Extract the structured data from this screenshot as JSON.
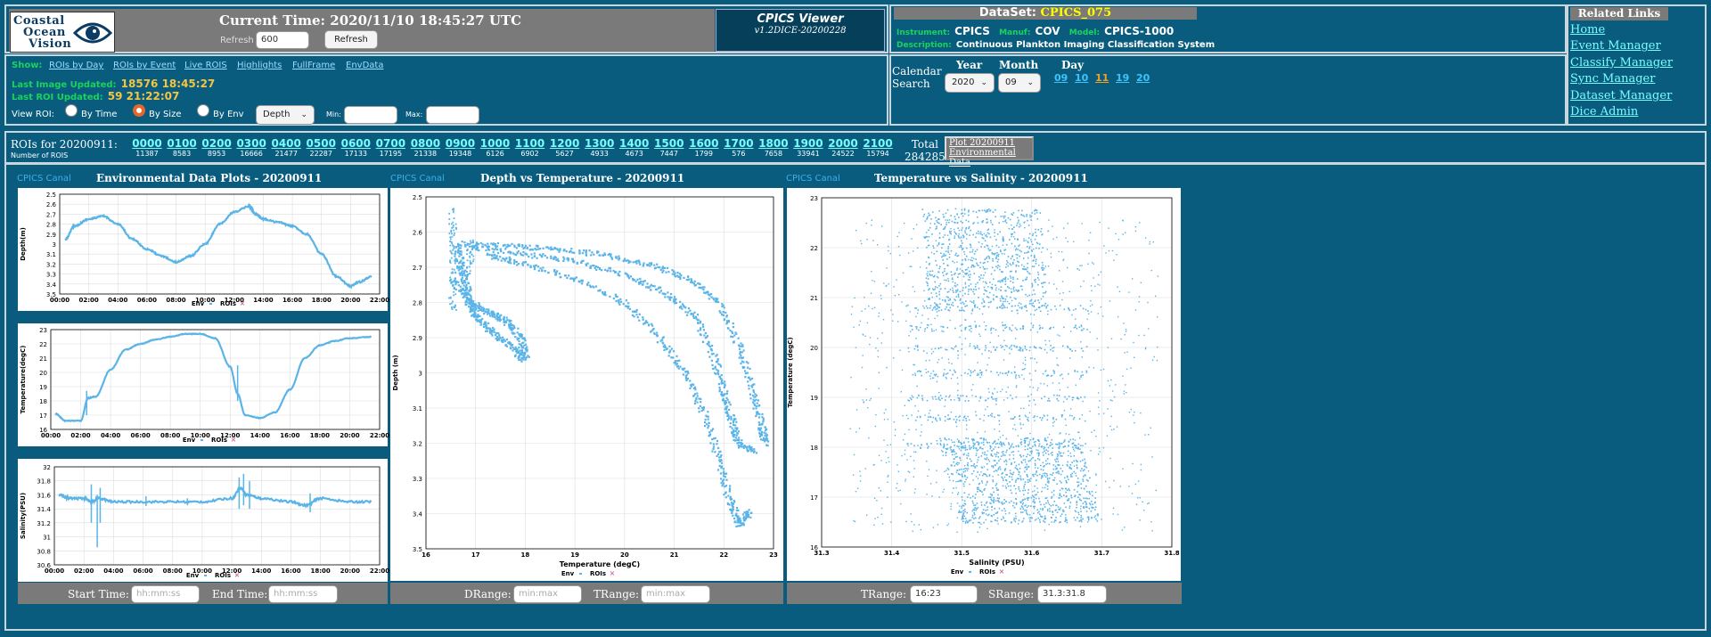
{
  "header": {
    "logo": {
      "line1": "Coastal",
      "line2": "Ocean",
      "line3": "Vision"
    },
    "current_time": "Current Time: 2020/11/10 18:45:27 UTC",
    "refresh_label": "Refresh",
    "refresh_value": "600",
    "refresh_button": "Refresh",
    "viewer_title": "CPICS Viewer",
    "viewer_version": "v1.2DICE-20200228"
  },
  "dataset": {
    "label": "DataSet:",
    "name": "CPICS_075",
    "instrument_label": "Instrument:",
    "instrument": "CPICS",
    "manuf_label": "Manuf:",
    "manuf": "COV",
    "model_label": "Model:",
    "model": "CPICS-1000",
    "description_label": "Description:",
    "description": "Continuous Plankton Imaging Classification System"
  },
  "related_links": {
    "title": "Related Links",
    "items": [
      "Home",
      "Event Manager",
      "Classify Manager",
      "Sync Manager",
      "Dataset Manager",
      "Dice Admin"
    ]
  },
  "show": {
    "label": "Show:",
    "links": [
      "ROIs by Day",
      "ROIs by Event",
      "Live ROIS",
      "Highlights",
      "FullFrame",
      "EnvData"
    ],
    "last_image_label": "Last Image Updated:",
    "last_image_value": "18576 18:45:27",
    "last_roi_label": "Last ROI Updated:",
    "last_roi_value": "59 21:22:07",
    "view_roi_label": "View ROI:",
    "radio_time": "By Time",
    "radio_size": "By Size",
    "radio_env": "By Env",
    "env_select": "Depth",
    "min_label": "Min:",
    "max_label": "Max:"
  },
  "calendar": {
    "label1": "Calendar",
    "label2": "Search",
    "year_label": "Year",
    "year": "2020",
    "month_label": "Month",
    "month": "09",
    "day_label": "Day",
    "days": [
      "09",
      "10",
      "11",
      "19",
      "20"
    ],
    "selected_day": "11"
  },
  "rois": {
    "title": "ROIs for 20200911:",
    "subtitle": "Number of ROIS",
    "hours": [
      {
        "h": "0000",
        "c": "11387"
      },
      {
        "h": "0100",
        "c": "8583"
      },
      {
        "h": "0200",
        "c": "8953"
      },
      {
        "h": "0300",
        "c": "16666"
      },
      {
        "h": "0400",
        "c": "21477"
      },
      {
        "h": "0500",
        "c": "22287"
      },
      {
        "h": "0600",
        "c": "17133"
      },
      {
        "h": "0700",
        "c": "17195"
      },
      {
        "h": "0800",
        "c": "21338"
      },
      {
        "h": "0900",
        "c": "19348"
      },
      {
        "h": "1000",
        "c": "6126"
      },
      {
        "h": "1100",
        "c": "6902"
      },
      {
        "h": "1200",
        "c": "5627"
      },
      {
        "h": "1300",
        "c": "4933"
      },
      {
        "h": "1400",
        "c": "4673"
      },
      {
        "h": "1500",
        "c": "7447"
      },
      {
        "h": "1600",
        "c": "1799"
      },
      {
        "h": "1700",
        "c": "576"
      },
      {
        "h": "1800",
        "c": "7658"
      },
      {
        "h": "1900",
        "c": "33941"
      },
      {
        "h": "2000",
        "c": "24522"
      },
      {
        "h": "2100",
        "c": "15794"
      }
    ],
    "total_label": "Total",
    "total": "284285",
    "plot_button_line1": "Plot 20200911",
    "plot_button_line2": "Environmental Data"
  },
  "plots": {
    "cp_tag": "CPICS Canal",
    "env_title": "Environmental Data Plots - 20200911",
    "dt_title": "Depth vs Temperature - 20200911",
    "ts_title": "Temperature vs Salinity - 20200911",
    "legend_env": "Env",
    "legend_rois": "ROIs"
  },
  "controls": {
    "start_label": "Start Time:",
    "start_placeholder": "hh:mm:ss",
    "end_label": "End Time:",
    "end_placeholder": "hh:mm:ss",
    "drange_label": "DRange:",
    "drange_placeholder": "min:max",
    "trange_label": "TRange:",
    "trange_placeholder": "min:max",
    "trange2_label": "TRange:",
    "trange2_value": "16:23",
    "srange_label": "SRange:",
    "srange_value": "31.3:31.8"
  },
  "chart_data": [
    {
      "type": "line",
      "ylabel": "Depth(m)",
      "x_ticks": [
        "00:00",
        "02:00",
        "04:00",
        "06:00",
        "08:00",
        "10:00",
        "12:00",
        "14:00",
        "16:00",
        "18:00",
        "20:00",
        "22:00"
      ],
      "y_ticks": [
        "2.5",
        "2.6",
        "2.7",
        "2.8",
        "2.9",
        "3",
        "3.1",
        "3.2",
        "3.3",
        "3.4",
        "3.5"
      ],
      "ylim": [
        3.5,
        2.5
      ],
      "series": [
        {
          "name": "Env",
          "x": [
            0.4,
            1,
            2,
            3,
            4,
            5,
            6,
            7,
            8,
            9,
            10,
            11,
            12,
            13,
            13.5,
            14,
            15,
            16,
            17,
            18,
            19,
            20,
            20.6,
            21.5
          ],
          "values": [
            2.95,
            2.82,
            2.75,
            2.72,
            2.8,
            2.95,
            3.05,
            3.12,
            3.18,
            3.12,
            3.0,
            2.8,
            2.68,
            2.62,
            2.7,
            2.75,
            2.78,
            2.82,
            2.9,
            3.1,
            3.32,
            3.42,
            3.38,
            3.32
          ]
        }
      ]
    },
    {
      "type": "line",
      "ylabel": "Temperature(degC)",
      "x_ticks": [
        "00:00",
        "02:00",
        "04:00",
        "06:00",
        "08:00",
        "10:00",
        "12:00",
        "14:00",
        "16:00",
        "18:00",
        "20:00",
        "22:00"
      ],
      "y_ticks": [
        "16",
        "17",
        "18",
        "19",
        "20",
        "21",
        "22",
        "23"
      ],
      "ylim": [
        16,
        23
      ],
      "series": [
        {
          "name": "Env",
          "x": [
            0.3,
            1,
            2,
            2.5,
            3,
            4,
            5,
            6,
            7,
            8,
            9,
            10,
            11,
            12,
            12.5,
            13,
            14,
            15,
            16,
            17,
            18,
            19,
            20,
            21.5
          ],
          "values": [
            17.1,
            16.6,
            16.6,
            18.2,
            18.3,
            20.2,
            21.6,
            22.0,
            22.3,
            22.5,
            22.7,
            22.7,
            22.4,
            20.4,
            18.5,
            17.0,
            16.8,
            17.2,
            18.8,
            21.0,
            21.9,
            22.2,
            22.4,
            22.5
          ]
        }
      ]
    },
    {
      "type": "line",
      "ylabel": "Salinity(PSU)",
      "x_ticks": [
        "00:00",
        "02:00",
        "04:00",
        "06:00",
        "08:00",
        "10:00",
        "12:00",
        "14:00",
        "16:00",
        "18:00",
        "20:00",
        "22:00"
      ],
      "y_ticks": [
        "30.6",
        "30.8",
        "31",
        "31.2",
        "31.4",
        "31.6",
        "31.8",
        "32"
      ],
      "ylim": [
        30.6,
        32
      ],
      "series": [
        {
          "name": "Env",
          "x": [
            0.3,
            1,
            2,
            2.5,
            3,
            4,
            6,
            8,
            10,
            12,
            12.6,
            13,
            14,
            16,
            17,
            18,
            20,
            21.5
          ],
          "values": [
            31.6,
            31.55,
            31.55,
            31.5,
            31.55,
            31.5,
            31.5,
            31.5,
            31.5,
            31.55,
            31.7,
            31.6,
            31.55,
            31.5,
            31.45,
            31.55,
            31.5,
            31.5
          ]
        }
      ]
    },
    {
      "type": "scatter",
      "xlabel": "Temperature (degC)",
      "ylabel": "Depth (m)",
      "x_ticks": [
        "16",
        "17",
        "18",
        "19",
        "20",
        "21",
        "22",
        "23"
      ],
      "y_ticks": [
        "2.5",
        "2.6",
        "2.7",
        "2.8",
        "2.9",
        "3",
        "3.1",
        "3.2",
        "3.3",
        "3.4",
        "3.5"
      ],
      "xlim": [
        16,
        23
      ],
      "ylim": [
        3.5,
        2.5
      ],
      "series": [
        {
          "name": "Env",
          "x": [
            16.6,
            16.8,
            17.5,
            18.5,
            19.5,
            20.5,
            21.5,
            22.0,
            22.4,
            22.7,
            22.8,
            22.2,
            21.4,
            20.6,
            19.4,
            18.5,
            17.6,
            17.0,
            16.6,
            16.5,
            16.7,
            21.8,
            22.3,
            22.5
          ],
          "values": [
            2.62,
            2.63,
            2.64,
            2.66,
            2.68,
            2.72,
            2.78,
            2.88,
            3.0,
            3.13,
            3.2,
            3.22,
            3.15,
            3.0,
            2.9,
            2.82,
            2.76,
            2.72,
            2.68,
            2.8,
            2.86,
            3.35,
            3.43,
            3.38
          ]
        }
      ]
    },
    {
      "type": "scatter",
      "xlabel": "Salinity (PSU)",
      "ylabel": "Temperature (degC)",
      "x_ticks": [
        "31.3",
        "31.4",
        "31.5",
        "31.6",
        "31.7",
        "31.8"
      ],
      "y_ticks": [
        "16",
        "17",
        "18",
        "19",
        "20",
        "21",
        "22",
        "23"
      ],
      "xlim": [
        31.3,
        31.8
      ],
      "ylim": [
        16,
        23
      ],
      "series": [
        {
          "name": "Env",
          "x": [
            31.47,
            31.52,
            31.6,
            31.62,
            31.55,
            31.5,
            31.48,
            31.5,
            31.58,
            31.45,
            31.4,
            31.65,
            31.68
          ],
          "values": [
            22.7,
            22.3,
            16.6,
            17.0,
            17.5,
            18.5,
            19.5,
            20.5,
            21.5,
            20.0,
            19.0,
            18.0,
            17.5
          ]
        }
      ]
    }
  ]
}
